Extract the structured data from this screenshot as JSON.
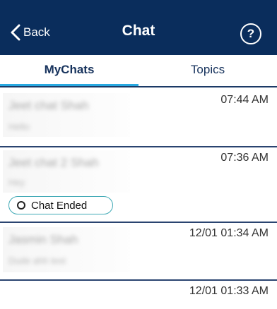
{
  "header": {
    "back_label": "Back",
    "title": "Chat",
    "help_symbol": "?"
  },
  "tabs": [
    {
      "label": "MyChats",
      "active": true
    },
    {
      "label": "Topics",
      "active": false
    }
  ],
  "chats": [
    {
      "name": "Jeet chat Shah",
      "preview": "Hello",
      "time": "07:44 AM"
    },
    {
      "name": "Jeet chat 2 Shah",
      "preview": "Hey",
      "time": "07:36 AM",
      "status": "Chat Ended"
    },
    {
      "name": "Jasmin Shah",
      "preview": "Dude ahh test",
      "time": "12/01 01:34 AM"
    },
    {
      "name": "",
      "preview": "",
      "time": "12/01 01:33 AM"
    }
  ],
  "colors": {
    "header_bg": "#0a2d5c",
    "tab_indicator": "#29a9e1",
    "badge_border": "#3fa9b5"
  }
}
